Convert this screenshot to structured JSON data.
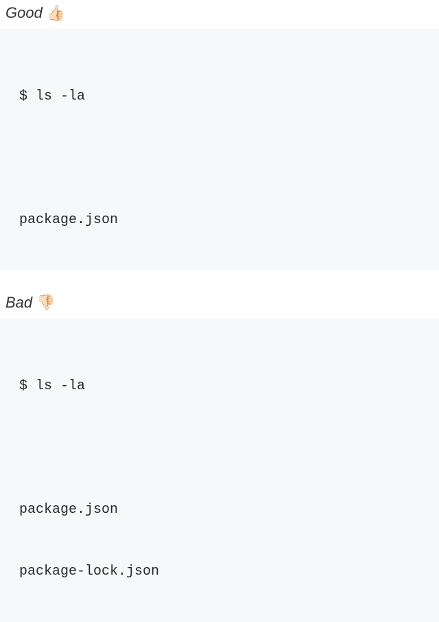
{
  "good": {
    "label": "Good",
    "emoji": "👍🏻",
    "code": {
      "command": "$ ls -la",
      "output": [
        "package.json"
      ]
    }
  },
  "bad": {
    "label": "Bad",
    "emoji": "👎🏻",
    "code": {
      "command": "$ ls -la",
      "output": [
        "package.json",
        "package-lock.json"
      ]
    }
  }
}
